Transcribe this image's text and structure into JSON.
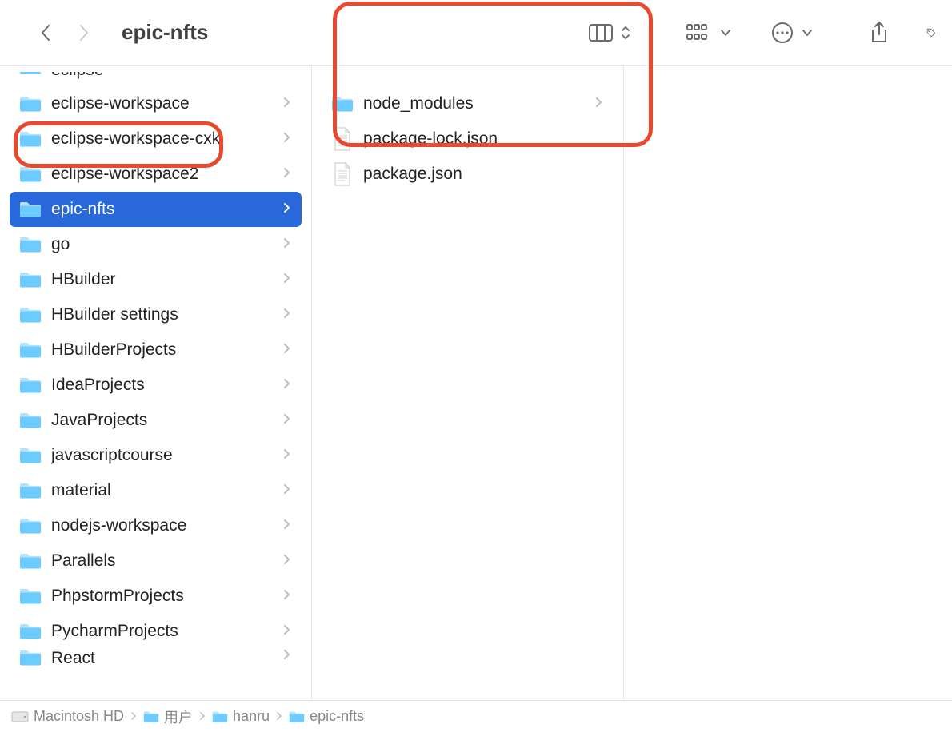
{
  "header": {
    "title": "epic-nfts"
  },
  "column1": {
    "items": [
      {
        "label": "eclipse",
        "type": "folder",
        "hasChildren": true,
        "partial": "top"
      },
      {
        "label": "eclipse-workspace",
        "type": "folder",
        "hasChildren": true
      },
      {
        "label": "eclipse-workspace-cxk",
        "type": "folder",
        "hasChildren": true
      },
      {
        "label": "eclipse-workspace2",
        "type": "folder",
        "hasChildren": true
      },
      {
        "label": "epic-nfts",
        "type": "folder",
        "hasChildren": true,
        "selected": true,
        "annotated": true
      },
      {
        "label": "go",
        "type": "folder",
        "hasChildren": true
      },
      {
        "label": "HBuilder",
        "type": "folder",
        "hasChildren": true
      },
      {
        "label": "HBuilder settings",
        "type": "folder",
        "hasChildren": true
      },
      {
        "label": "HBuilderProjects",
        "type": "folder",
        "hasChildren": true
      },
      {
        "label": "IdeaProjects",
        "type": "folder",
        "hasChildren": true
      },
      {
        "label": "JavaProjects",
        "type": "folder",
        "hasChildren": true
      },
      {
        "label": "javascriptcourse",
        "type": "folder",
        "hasChildren": true
      },
      {
        "label": "material",
        "type": "folder",
        "hasChildren": true
      },
      {
        "label": "nodejs-workspace",
        "type": "folder",
        "hasChildren": true
      },
      {
        "label": "Parallels",
        "type": "folder",
        "hasChildren": true
      },
      {
        "label": "PhpstormProjects",
        "type": "folder",
        "hasChildren": true
      },
      {
        "label": "PycharmProjects",
        "type": "folder",
        "hasChildren": true
      },
      {
        "label": "React",
        "type": "folder",
        "hasChildren": true,
        "partial": "bottom"
      }
    ]
  },
  "column2": {
    "annotated": true,
    "items": [
      {
        "label": "node_modules",
        "type": "folder",
        "hasChildren": true
      },
      {
        "label": "package-lock.json",
        "type": "file-text",
        "hasChildren": false
      },
      {
        "label": "package.json",
        "type": "file-blank",
        "hasChildren": false
      }
    ]
  },
  "pathbar": {
    "items": [
      {
        "label": "Macintosh HD",
        "icon": "disk"
      },
      {
        "label": "用户",
        "icon": "folder"
      },
      {
        "label": "hanru",
        "icon": "folder"
      },
      {
        "label": "epic-nfts",
        "icon": "folder"
      }
    ]
  }
}
